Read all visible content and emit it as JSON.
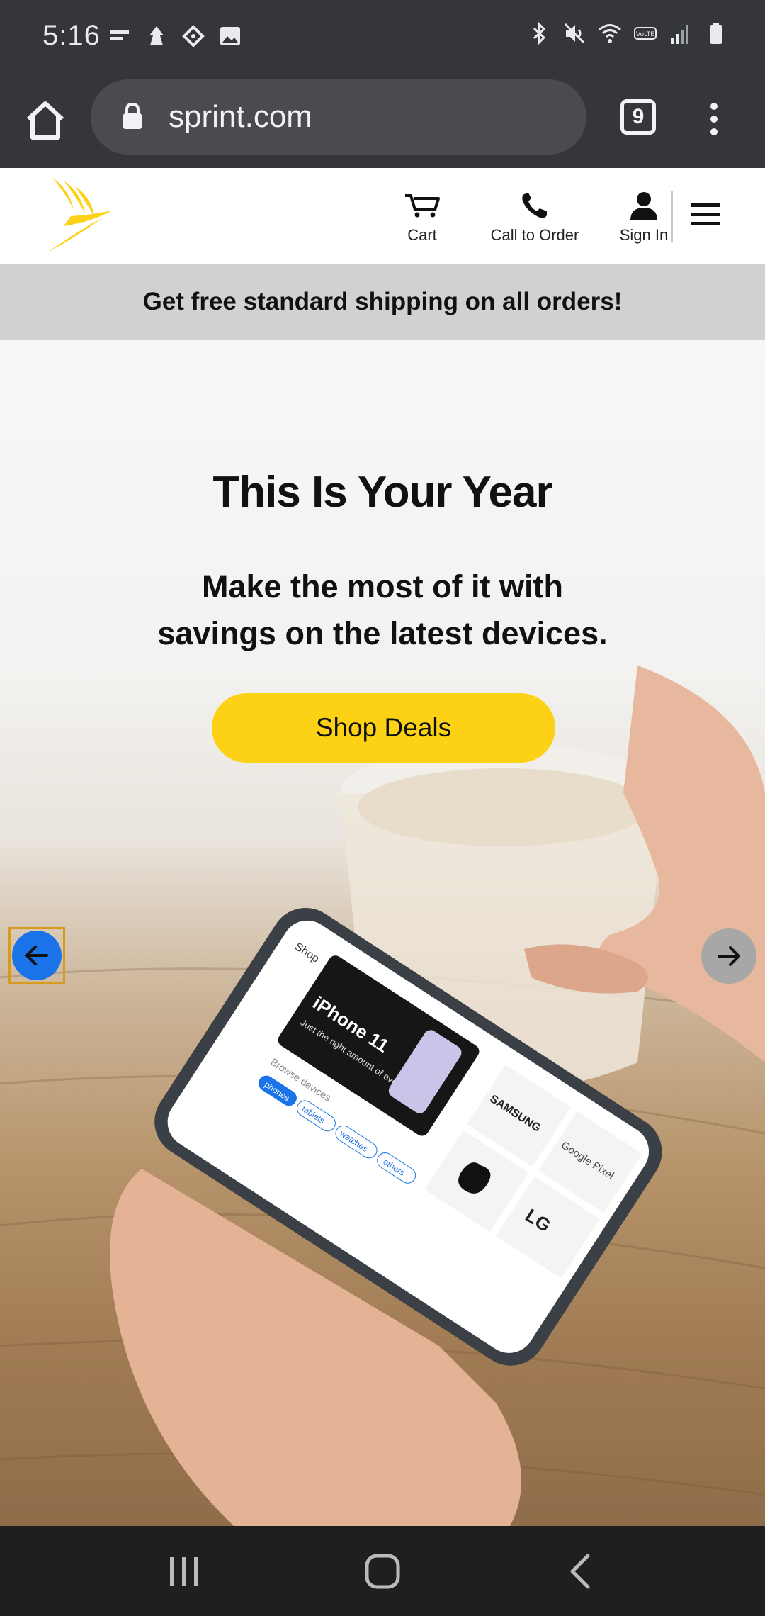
{
  "status_bar": {
    "time": "5:16",
    "icons_left": [
      "notification-icon",
      "app-icon",
      "ticket-icon",
      "image-icon"
    ],
    "icons_right": [
      "bluetooth-icon",
      "mute-icon",
      "wifi-icon",
      "volte-icon",
      "signal-icon",
      "battery-icon"
    ]
  },
  "browser": {
    "url": "sprint.com",
    "tab_count": "9"
  },
  "header": {
    "cart_label": "Cart",
    "call_label": "Call to Order",
    "signin_label": "Sign In",
    "brand_color": "#fcd116"
  },
  "promo": {
    "text": "Get free standard shipping on all orders!"
  },
  "hero": {
    "title": "This Is Your Year",
    "subtitle_line1": "Make the most of it with",
    "subtitle_line2": "savings on the latest devices.",
    "cta_label": "Shop Deals",
    "cta_color": "#fcd116",
    "phone_screen": {
      "header": "Shop",
      "promo_title": "iPhone 11",
      "promo_text": "Just the right amount of everything.",
      "section_label": "Browse devices",
      "chips": [
        "phones",
        "tablets",
        "watches",
        "others"
      ],
      "brands": [
        "SAMSUNG",
        "Google Pixel",
        "LG"
      ]
    }
  },
  "carousel": {
    "prev_icon": "arrow-left-icon",
    "next_icon": "arrow-right-icon",
    "active_color": "#1a73e8"
  }
}
